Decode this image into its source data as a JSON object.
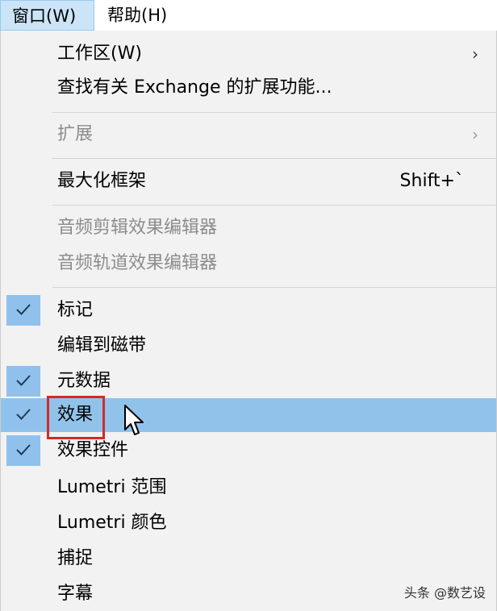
{
  "menubar": {
    "window": "窗口(W)",
    "help": "帮助(H)"
  },
  "menu": {
    "workspace": "工作区(W)",
    "exchange": "查找有关 Exchange 的扩展功能...",
    "extensions": "扩展",
    "maximize_frame": "最大化框架",
    "maximize_shortcut": "Shift+`",
    "audio_clip_effects": "音频剪辑效果编辑器",
    "audio_track_effects": "音频轨道效果编辑器",
    "markers": "标记",
    "edit_to_tape": "编辑到磁带",
    "metadata": "元数据",
    "effects": "效果",
    "effect_controls": "效果控件",
    "lumetri_scopes": "Lumetri 范围",
    "lumetri_color": "Lumetri 颜色",
    "capture": "捕捉",
    "captions": "字幕"
  },
  "checked": {
    "markers": true,
    "metadata": true,
    "effects": true,
    "effect_controls": true
  },
  "watermark": "头条 @数艺设",
  "colors": {
    "highlight": "#91c3ea",
    "check_bg": "#8fc1ec",
    "red_box": "#d32a2a",
    "disabled_text": "#8c8c8c"
  }
}
